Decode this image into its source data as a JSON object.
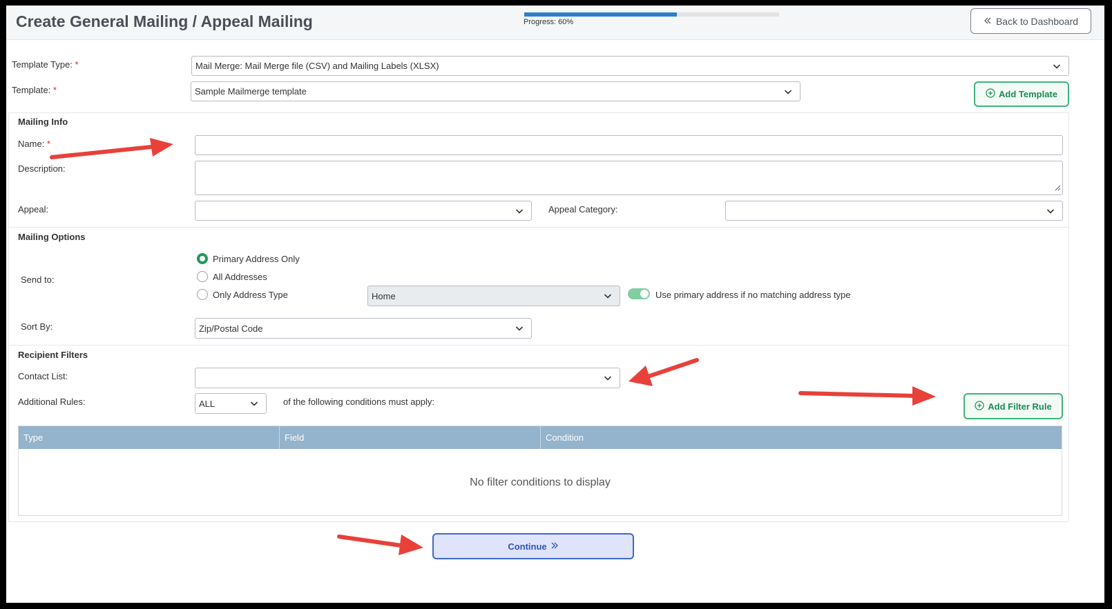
{
  "header": {
    "title": "Create General Mailing / Appeal Mailing",
    "progress_label": "Progress: 60%",
    "progress_value": 0.6,
    "back_button": "Back to Dashboard"
  },
  "template": {
    "type_label": "Template Type:",
    "type_value": "Mail Merge: Mail Merge file (CSV) and Mailing Labels (XLSX)",
    "template_label": "Template:",
    "template_value": "Sample Mailmerge template",
    "add_template_button": "Add Template",
    "required_mark": "*"
  },
  "mailing_info": {
    "section_title": "Mailing Info",
    "name_label": "Name:",
    "name_value": "",
    "description_label": "Description:",
    "description_value": "",
    "appeal_label": "Appeal:",
    "appeal_value": "",
    "appeal_category_label": "Appeal Category:",
    "appeal_category_value": ""
  },
  "mailing_options": {
    "section_title": "Mailing Options",
    "send_to_label": "Send to:",
    "radio_primary": "Primary Address Only",
    "radio_all": "All Addresses",
    "radio_only_type": "Only Address Type",
    "selected_option": "Primary Address Only",
    "address_type_value": "Home",
    "use_primary_toggle_label": "Use primary address if no matching address type",
    "use_primary_toggle_on": true,
    "sort_by_label": "Sort By:",
    "sort_by_value": "Zip/Postal Code"
  },
  "recipient_filters": {
    "section_title": "Recipient Filters",
    "contact_list_label": "Contact List:",
    "contact_list_value": "",
    "additional_rules_label": "Additional Rules:",
    "rules_match_value": "ALL",
    "rules_suffix": "of the following conditions must apply:",
    "add_filter_button": "Add Filter Rule",
    "table": {
      "columns": [
        "Type",
        "Field",
        "Condition"
      ],
      "empty_message": "No filter conditions to display"
    }
  },
  "footer": {
    "continue_button": "Continue"
  },
  "colors": {
    "accent_green": "#1d9a58",
    "progress_blue": "#2f7ec8",
    "annotation_red": "#e8413a",
    "table_header": "#94b3cc"
  }
}
